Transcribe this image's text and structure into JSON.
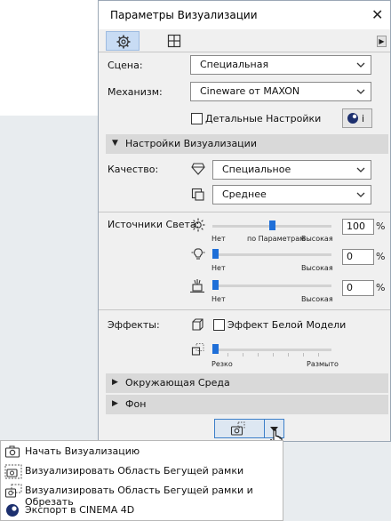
{
  "dialog": {
    "title": "Параметры Визуализации"
  },
  "scene": {
    "label": "Сцена:",
    "value": "Специальная"
  },
  "engine": {
    "label": "Механизм:",
    "value": "Cineware от MAXON"
  },
  "detailed": {
    "label": "Детальные Настройки",
    "checked": false
  },
  "render_settings": {
    "header": "Настройки Визуализации",
    "quality_label": "Качество:",
    "quality_value": "Специальное",
    "quality2_value": "Среднее"
  },
  "lights": {
    "label": "Источники Света:",
    "row1": {
      "value": "100",
      "unit": "%",
      "left": "Нет",
      "mid": "по Параметрам",
      "right": "Высокая",
      "level": 0.5
    },
    "row2": {
      "value": "0",
      "unit": "%",
      "left": "Нет",
      "right": "Высокая",
      "level": 0
    },
    "row3": {
      "value": "0",
      "unit": "%",
      "left": "Нет",
      "right": "Высокая",
      "level": 0
    }
  },
  "effects": {
    "label": "Эффекты:",
    "white_model_label": "Эффект Белой Модели",
    "white_model_checked": false,
    "blur_left": "Резко",
    "blur_right": "Размыто",
    "blur_level": 0
  },
  "sections": {
    "environment": "Окружающая Среда",
    "background": "Фон"
  },
  "menu": {
    "items": [
      {
        "label": "Начать Визуализацию",
        "icon": "camera-icon"
      },
      {
        "label": "Визуализировать Область Бегущей рамки",
        "icon": "marquee-camera-icon"
      },
      {
        "label": "Визуализировать Область Бегущей рамки и Обрезать",
        "icon": "marquee-crop-camera-icon"
      },
      {
        "label": "Экспорт в CINEMA 4D",
        "icon": "cinema4d-icon"
      }
    ]
  }
}
